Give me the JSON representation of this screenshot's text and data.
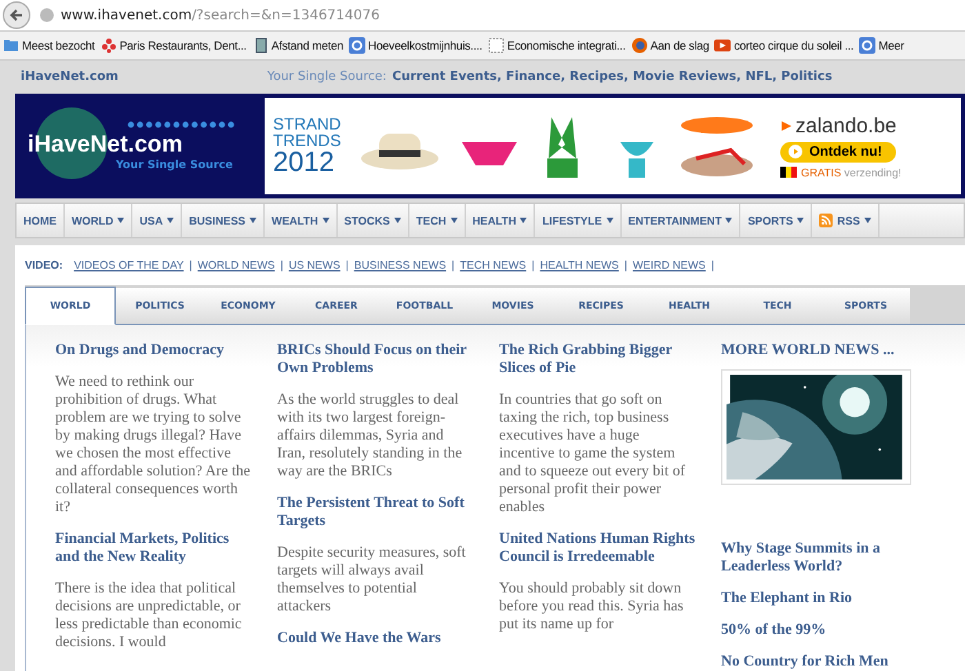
{
  "browser": {
    "url_domain": "www.ihavenet.com",
    "url_rest": "/?search=&n=1346714076",
    "bookmarks": [
      {
        "label": "Meest bezocht",
        "kind": "folder"
      },
      {
        "label": "Paris Restaurants, Dent...",
        "kind": "star"
      },
      {
        "label": "Afstand meten",
        "kind": "page"
      },
      {
        "label": "Hoeveelkostmijnhuis....",
        "kind": "blue"
      },
      {
        "label": "Economische integrati...",
        "kind": "blank"
      },
      {
        "label": "Aan de slag",
        "kind": "firefox"
      },
      {
        "label": "corteo cirque du soleil ...",
        "kind": "video"
      },
      {
        "label": "Meer",
        "kind": "blue"
      }
    ]
  },
  "site_header": {
    "name": "iHaveNet.com",
    "tagline_lead": "Your Single Source:",
    "tagline_topics": "Current Events, Finance, Recipes, Movie Reviews, NFL, Politics"
  },
  "logo": {
    "name": "iHaveNet.com",
    "slogan": "Your Single Source"
  },
  "ad": {
    "headline": "STRAND TRENDS",
    "year": "2012",
    "brand": "zalando.be",
    "cta": "Ontdek nu!",
    "shipping_lead": "GRATIS",
    "shipping_rest": "verzending!"
  },
  "nav": [
    {
      "label": "HOME",
      "dropdown": false,
      "rss": false
    },
    {
      "label": "WORLD",
      "dropdown": true,
      "rss": false
    },
    {
      "label": "USA",
      "dropdown": true,
      "rss": false
    },
    {
      "label": "BUSINESS",
      "dropdown": true,
      "rss": false
    },
    {
      "label": "WEALTH",
      "dropdown": true,
      "rss": false
    },
    {
      "label": "STOCKS",
      "dropdown": true,
      "rss": false
    },
    {
      "label": "TECH",
      "dropdown": true,
      "rss": false
    },
    {
      "label": "HEALTH",
      "dropdown": true,
      "rss": false
    },
    {
      "label": "LIFESTYLE",
      "dropdown": true,
      "rss": false
    },
    {
      "label": "ENTERTAINMENT",
      "dropdown": true,
      "rss": false
    },
    {
      "label": "SPORTS",
      "dropdown": true,
      "rss": false
    },
    {
      "label": "RSS",
      "dropdown": true,
      "rss": true
    }
  ],
  "video": {
    "label": "VIDEO:",
    "separator": "|",
    "links": [
      "VIDEOS OF THE DAY",
      "WORLD NEWS",
      "US NEWS",
      "BUSINESS NEWS",
      "TECH NEWS",
      "HEALTH NEWS",
      "WEIRD NEWS"
    ]
  },
  "tabs": [
    {
      "label": "WORLD",
      "selected": true
    },
    {
      "label": "POLITICS",
      "selected": false
    },
    {
      "label": "ECONOMY",
      "selected": false
    },
    {
      "label": "CAREER",
      "selected": false
    },
    {
      "label": "FOOTBALL",
      "selected": false
    },
    {
      "label": "MOVIES",
      "selected": false
    },
    {
      "label": "RECIPES",
      "selected": false
    },
    {
      "label": "HEALTH",
      "selected": false
    },
    {
      "label": "TECH",
      "selected": false
    },
    {
      "label": "SPORTS",
      "selected": false
    }
  ],
  "columns": [
    {
      "articles": [
        {
          "title": "On Drugs and Democracy",
          "summary": "We need to rethink our prohibition of drugs. What problem are we trying to solve by making drugs illegal? Have we chosen the most effective and affordable solution? Are the collateral consequences worth it?"
        },
        {
          "title": "Financial Markets, Politics and the New Reality",
          "summary": "There is the idea that political decisions are unpredictable, or less predictable than economic decisions. I would"
        }
      ]
    },
    {
      "articles": [
        {
          "title": "BRICs Should Focus on their Own Problems",
          "summary": "As the world struggles to deal with its two largest foreign-affairs dilemmas, Syria and Iran, resolutely standing in the way are the BRICs"
        },
        {
          "title": "The Persistent Threat to Soft Targets",
          "summary": "Despite security measures, soft targets will always avail themselves to potential attackers"
        },
        {
          "title": "Could We Have the Wars"
        }
      ]
    },
    {
      "articles": [
        {
          "title": "The Rich Grabbing Bigger Slices of Pie",
          "summary": "In countries that go soft on taxing the rich, top business executives have a huge incentive to game the system and to squeeze out every bit of personal profit their power enables"
        },
        {
          "title": "United Nations Human Rights Council is Irredeemable",
          "summary": "You should probably sit down before you read this. Syria has put its name up for"
        }
      ]
    }
  ],
  "more": {
    "heading": "MORE WORLD NEWS ...",
    "links": [
      "Why Stage Summits in a Leaderless World?",
      "The Elephant in Rio",
      "50% of the 99%",
      "No Country for Rich Men"
    ]
  }
}
